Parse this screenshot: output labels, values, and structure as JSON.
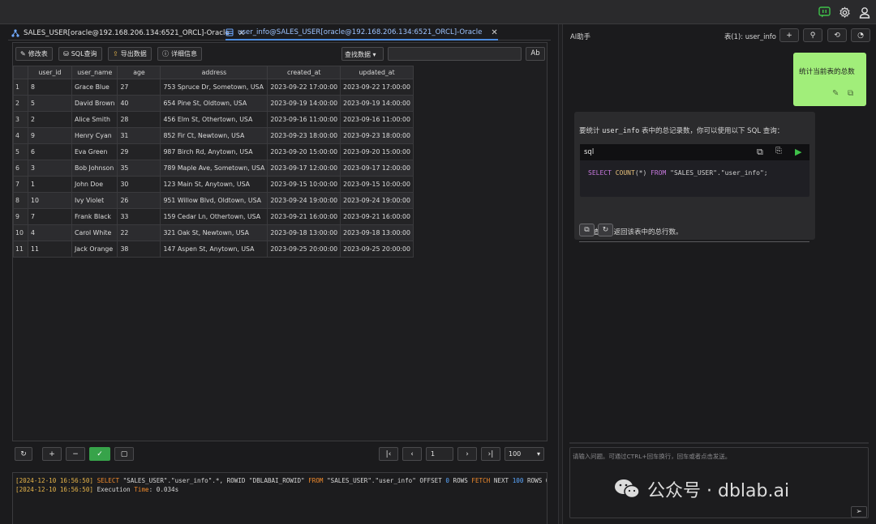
{
  "colors": {
    "accent_blue": "#4d8de0",
    "user_bubble": "#a1ee7a",
    "run_green": "#3fc24a",
    "log_timestamp": "#e7b54a",
    "log_keyword": "#f08a2c"
  },
  "topbar": {
    "icons": [
      "assistant-icon",
      "gear-icon",
      "user-icon"
    ]
  },
  "tabs": [
    {
      "label": "SALES_USER[oracle@192.168.206.134:6521_ORCL]-Oracle",
      "icon": "connection-tree-icon",
      "active": false
    },
    {
      "label": "user_info@SALES_USER[oracle@192.168.206.134:6521_ORCL]-Oracle",
      "icon": "table-icon",
      "active": true
    }
  ],
  "toolbar": {
    "modify_table": "修改表",
    "sql_query": "SQL查询",
    "export_data": "导出数据",
    "details": "详细信息",
    "search_select": "查找数据",
    "search_value": "",
    "case_toggle": "Ab"
  },
  "table": {
    "columns": [
      "user_id",
      "user_name",
      "age",
      "address",
      "created_at",
      "updated_at"
    ],
    "rows": [
      [
        "1",
        "8",
        "Grace Blue",
        "27",
        "753 Spruce Dr, Sometown, USA",
        "2023-09-22 17:00:00",
        "2023-09-22 17:00:00"
      ],
      [
        "2",
        "5",
        "David Brown",
        "40",
        "654 Pine St, Oldtown, USA",
        "2023-09-19 14:00:00",
        "2023-09-19 14:00:00"
      ],
      [
        "3",
        "2",
        "Alice Smith",
        "28",
        "456 Elm St, Othertown, USA",
        "2023-09-16 11:00:00",
        "2023-09-16 11:00:00"
      ],
      [
        "4",
        "9",
        "Henry Cyan",
        "31",
        "852 Fir Ct, Newtown, USA",
        "2023-09-23 18:00:00",
        "2023-09-23 18:00:00"
      ],
      [
        "5",
        "6",
        "Eva Green",
        "29",
        "987 Birch Rd, Anytown, USA",
        "2023-09-20 15:00:00",
        "2023-09-20 15:00:00"
      ],
      [
        "6",
        "3",
        "Bob Johnson",
        "35",
        "789 Maple Ave, Sometown, USA",
        "2023-09-17 12:00:00",
        "2023-09-17 12:00:00"
      ],
      [
        "7",
        "1",
        "John Doe",
        "30",
        "123 Main St, Anytown, USA",
        "2023-09-15 10:00:00",
        "2023-09-15 10:00:00"
      ],
      [
        "8",
        "10",
        "Ivy Violet",
        "26",
        "951 Willow Blvd, Oldtown, USA",
        "2023-09-24 19:00:00",
        "2023-09-24 19:00:00"
      ],
      [
        "9",
        "7",
        "Frank Black",
        "33",
        "159 Cedar Ln, Othertown, USA",
        "2023-09-21 16:00:00",
        "2023-09-21 16:00:00"
      ],
      [
        "10",
        "4",
        "Carol White",
        "22",
        "321 Oak St, Newtown, USA",
        "2023-09-18 13:00:00",
        "2023-09-18 13:00:00"
      ],
      [
        "11",
        "11",
        "Jack Orange",
        "38",
        "147 Aspen St, Anytown, USA",
        "2023-09-25 20:00:00",
        "2023-09-25 20:00:00"
      ]
    ]
  },
  "pager": {
    "page": "1",
    "page_size": "100"
  },
  "log": {
    "line1": {
      "ts": "[2024-12-10 16:56:50]",
      "kw_select": "SELECT",
      "t1": " \"SALES_USER\".\"user_info\".*, ROWID \"DBLABAI_ROWID\" ",
      "kw_from": "FROM",
      "t2": " \"SALES_USER\".\"user_info\"  OFFSET ",
      "n1": "0",
      "t3": " ROWS ",
      "kw_fetch": "FETCH",
      "t4": " NEXT ",
      "n2": "100",
      "t5": " ROWS ONLY"
    },
    "line2": {
      "ts": "[2024-12-10 16:56:50]",
      "t1": " Execution ",
      "kw_time": "Time",
      "t2": ": 0.034s"
    }
  },
  "assistant": {
    "title": "AI助手",
    "table_label": "表(1):  user_info",
    "user_message": "统计当前表的总数",
    "ai_intro_a": "要统计 ",
    "ai_intro_code": "user_info",
    "ai_intro_b": " 表中的总记录数，你可以使用以下 SQL 查询：",
    "code_lang": "sql",
    "code": {
      "select": "SELECT",
      "count": "COUNT",
      "args": "(*) ",
      "from": "FROM",
      "rest": " \"SALES_USER\".\"user_info\";"
    },
    "ai_outro": "这个查询会返回该表中的总行数。",
    "input_placeholder": "请输入问题。可通过CTRL+回车换行，回车或者点击发送。"
  },
  "watermark": {
    "text": "公众号 · dblab.ai",
    "icon": "wechat-icon"
  }
}
